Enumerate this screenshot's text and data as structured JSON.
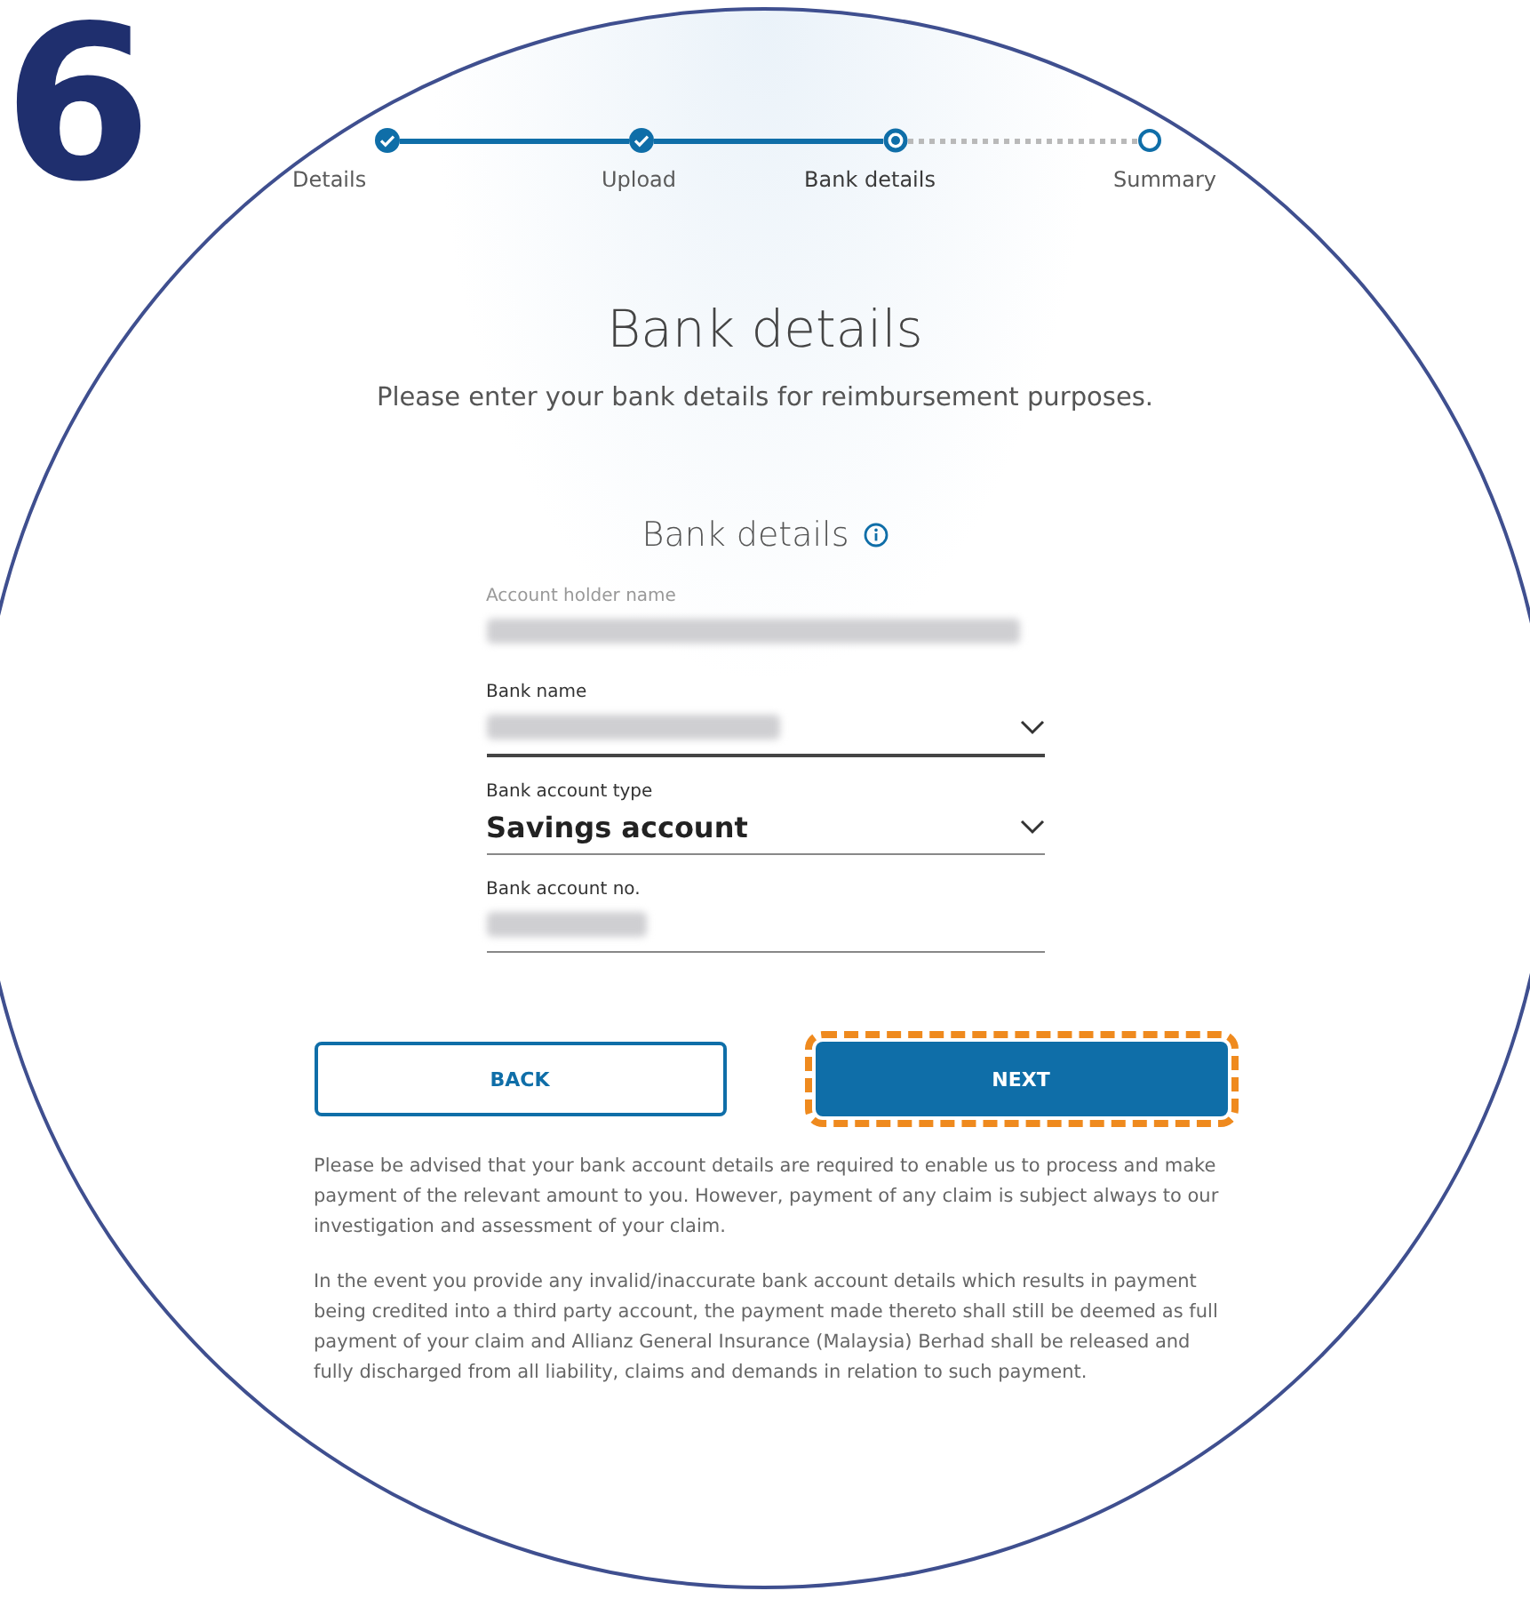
{
  "step_number": "6",
  "steps": [
    {
      "label": "Details",
      "completed": true,
      "selected": false
    },
    {
      "label": "Upload",
      "completed": true,
      "selected": false
    },
    {
      "label": "Bank details",
      "completed": false,
      "selected": true
    },
    {
      "label": "Summary",
      "completed": false,
      "selected": false
    }
  ],
  "title": "Bank details",
  "subtitle": "Please enter your bank details for reimbursement purposes.",
  "section_title": "Bank details",
  "fields": [
    {
      "label": "Account holder name",
      "kind": "text",
      "redacted": true,
      "focused": false
    },
    {
      "label": "Bank name",
      "kind": "select",
      "redacted": true,
      "focused": true
    },
    {
      "label": "Bank account type",
      "kind": "select",
      "redacted": false,
      "value": "Savings account",
      "focused": false
    },
    {
      "label": "Bank account no.",
      "kind": "input",
      "redacted": true,
      "focused": false
    }
  ],
  "buttons": [
    {
      "label": "BACK",
      "kind": "secondary",
      "highlighted": false
    },
    {
      "label": "NEXT",
      "kind": "primary",
      "highlighted": true
    }
  ],
  "notes": [
    "Please be advised that your bank account details are required to enable us to process and make payment of the relevant amount to you. However, payment of any claim is subject always to our investigation and assessment of your claim.",
    "In the event you provide any invalid/inaccurate bank account details which results in payment being credited into a third party account, the payment made thereto shall still be deemed as full payment of your claim and Allianz General Insurance (Malaysia) Berhad shall be released and fully discharged from all liability, claims and demands in relation to such payment."
  ]
}
